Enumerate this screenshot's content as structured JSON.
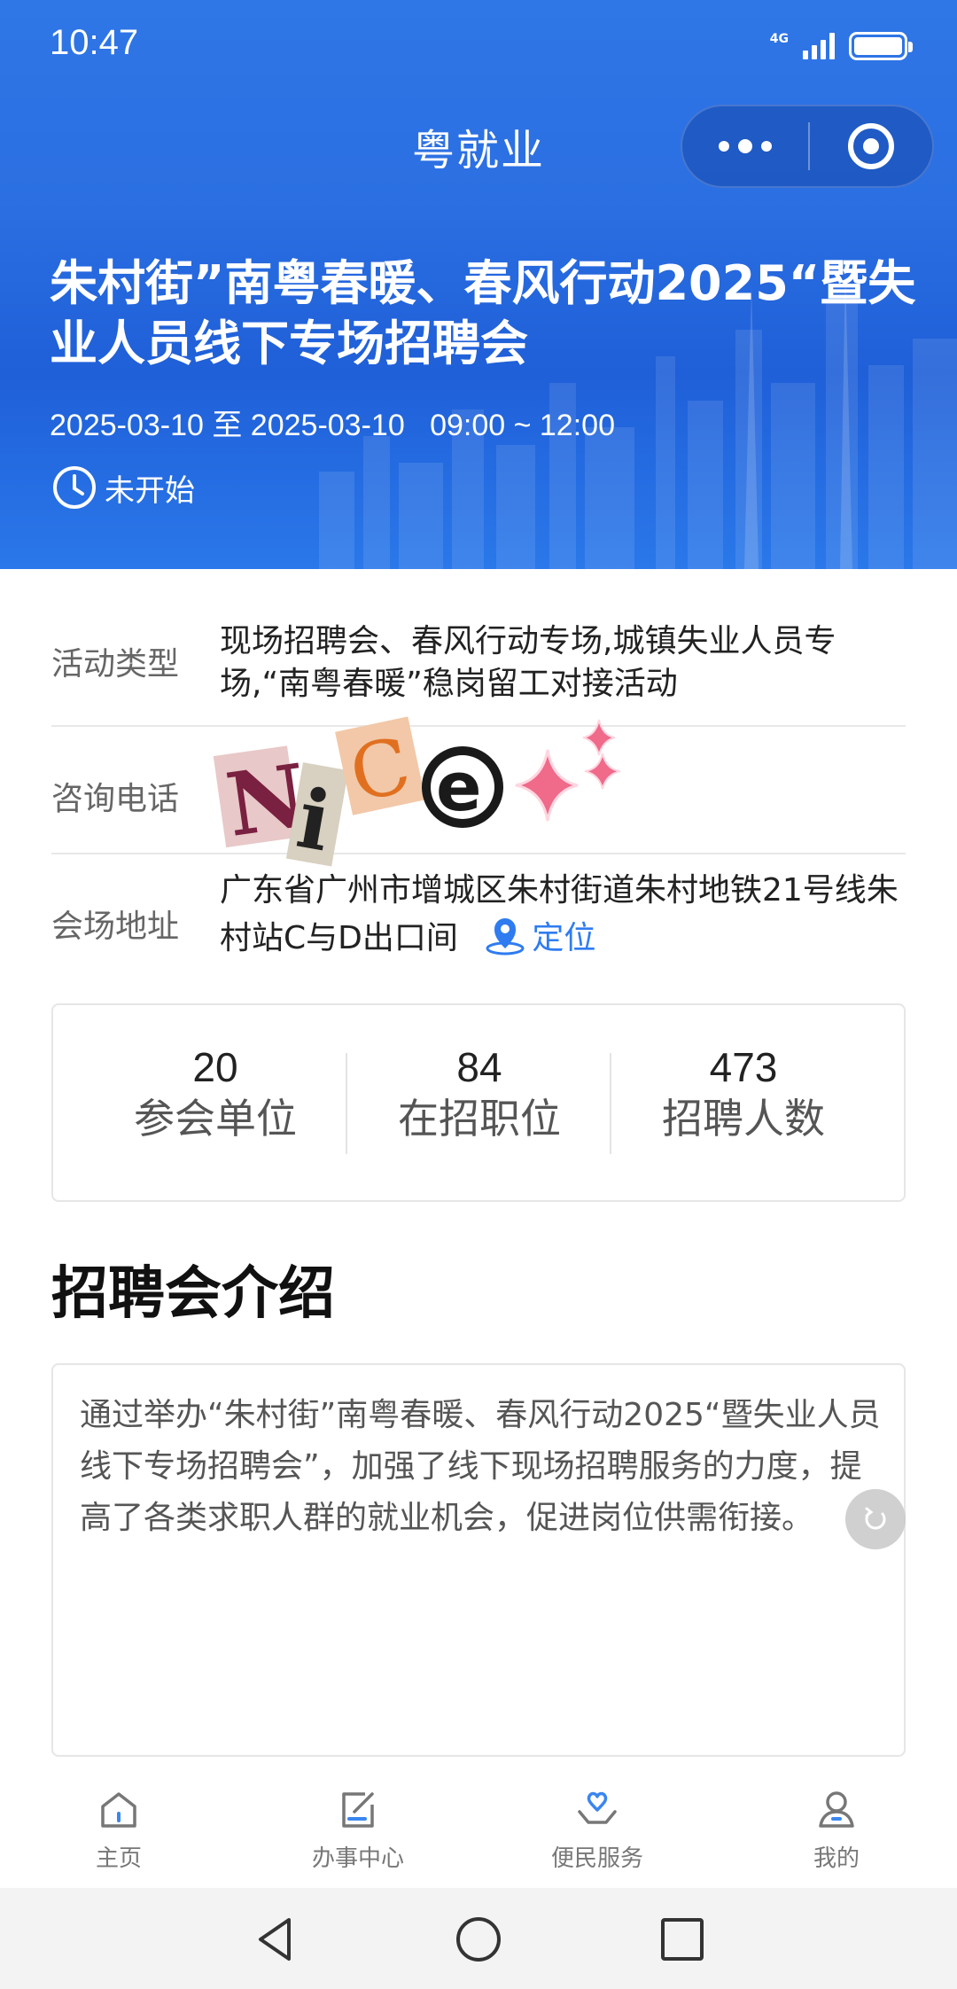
{
  "status_bar": {
    "time": "10:47",
    "network": "4G"
  },
  "nav": {
    "title": "粤就业"
  },
  "banner": {
    "title": "朱村街”南粤春暖、春风行动2025“暨失业人员线下专场招聘会",
    "date_range": "2025-03-10 至 2025-03-10   09:00 ~ 12:00",
    "status": "未开始"
  },
  "info": {
    "type_label": "活动类型",
    "type_value": "现场招聘会、春风行动专场,城镇失业人员专场,“南粤春暖”稳岗留工对接活动",
    "phone_label": "咨询电话",
    "phone_value": "",
    "address_label": "会场地址",
    "address_value": "广东省广州市增城区朱村街道朱村地铁21号线朱村站C与D出口间",
    "locate_label": "定位"
  },
  "stats": [
    {
      "value": "20",
      "label": "参会单位"
    },
    {
      "value": "84",
      "label": "在招职位"
    },
    {
      "value": "473",
      "label": "招聘人数"
    }
  ],
  "intro": {
    "heading": "招聘会介绍",
    "text": "通过举办“朱村街”南粤春暖、春风行动2025“暨失业人员线下专场招聘会”，加强了线下现场招聘服务的力度，提高了各类求职人群的就业机会，促进岗位供需衔接。"
  },
  "tabbar": {
    "items": [
      {
        "label": "主页",
        "icon": "home-icon"
      },
      {
        "label": "办事中心",
        "icon": "edit-icon"
      },
      {
        "label": "便民服务",
        "icon": "heart-hand-icon"
      },
      {
        "label": "我的",
        "icon": "user-icon"
      }
    ],
    "active_index": 2
  },
  "colors": {
    "header_blue": "#2b6fe2",
    "link_blue": "#2f7cf0",
    "text_dark": "#222222",
    "text_grey": "#666666"
  }
}
